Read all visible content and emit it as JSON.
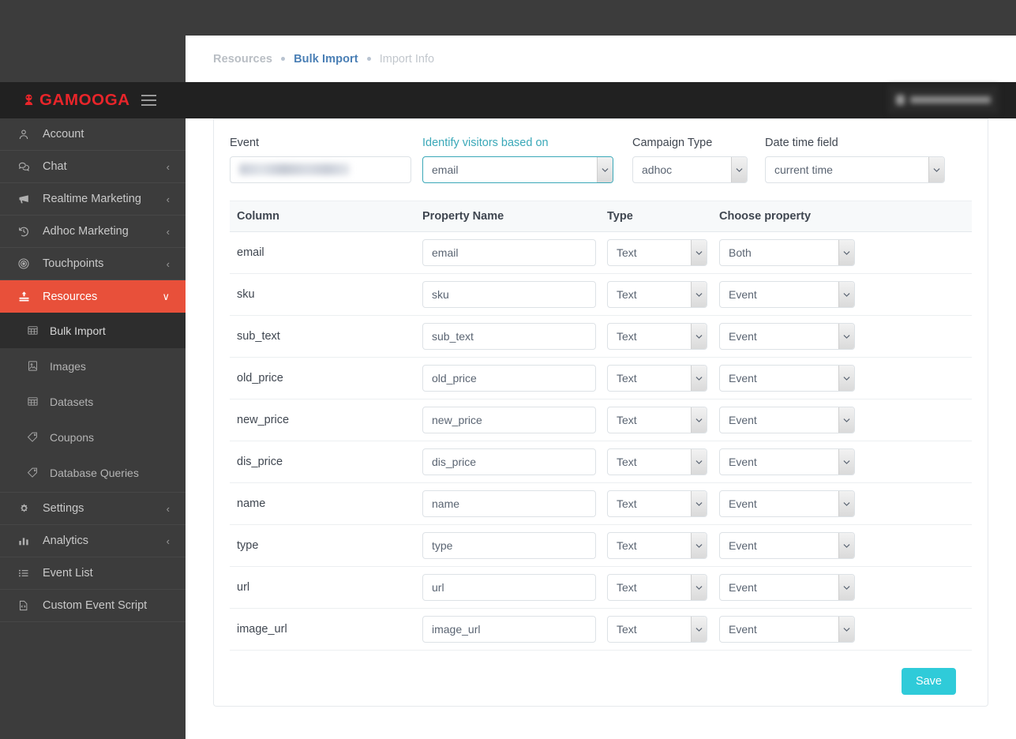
{
  "brand": {
    "name": "GAMOOGA",
    "color": "#e8252a",
    "logo_icon": "gamooga-logo-icon",
    "menu_icon": "hamburger-icon"
  },
  "user": {
    "name_redacted": true,
    "avatar_icon": "user-avatar-icon"
  },
  "breadcrumb": {
    "root": "Resources",
    "section": "Bulk Import",
    "current": "Import Info",
    "separator_icon": "dot-separator-icon"
  },
  "sidebar": {
    "items": [
      {
        "label": "Account",
        "icon": "user-icon",
        "caret": "",
        "active": false
      },
      {
        "label": "Chat",
        "icon": "chat-bubbles-icon",
        "caret": "‹",
        "active": false
      },
      {
        "label": "Realtime Marketing",
        "icon": "megaphone-icon",
        "caret": "‹",
        "active": false
      },
      {
        "label": "Adhoc Marketing",
        "icon": "history-icon",
        "caret": "‹",
        "active": false
      },
      {
        "label": "Touchpoints",
        "icon": "target-icon",
        "caret": "‹",
        "active": false
      },
      {
        "label": "Resources",
        "icon": "upload-icon",
        "caret": "∨",
        "active": true
      }
    ],
    "sub_items": [
      {
        "label": "Bulk Import",
        "icon": "table-grid-icon",
        "selected": true
      },
      {
        "label": "Images",
        "icon": "image-icon",
        "selected": false
      },
      {
        "label": "Datasets",
        "icon": "table-grid-icon",
        "selected": false
      },
      {
        "label": "Coupons",
        "icon": "tag-icon",
        "selected": false
      },
      {
        "label": "Database Queries",
        "icon": "tag-icon",
        "selected": false
      }
    ],
    "items_bottom": [
      {
        "label": "Settings",
        "icon": "gears-icon",
        "caret": "‹"
      },
      {
        "label": "Analytics",
        "icon": "bar-chart-icon",
        "caret": "‹"
      },
      {
        "label": "Event List",
        "icon": "list-icon",
        "caret": ""
      },
      {
        "label": "Custom Event Script",
        "icon": "code-file-icon",
        "caret": ""
      }
    ]
  },
  "form": {
    "event": {
      "label": "Event",
      "value": "",
      "redacted": true
    },
    "identify_visitors": {
      "label": "Identify visitors based on",
      "value": "email",
      "highlighted": true,
      "accent": "#3aa8b8"
    },
    "campaign_type": {
      "label": "Campaign Type",
      "value": "adhoc"
    },
    "date_time_field": {
      "label": "Date time field",
      "value": "current time"
    }
  },
  "table": {
    "headers": [
      "Column",
      "Property Name",
      "Type",
      "Choose property"
    ],
    "rows": [
      {
        "column": "email",
        "property_name": "email",
        "type": "Text",
        "choose_property": "Both"
      },
      {
        "column": "sku",
        "property_name": "sku",
        "type": "Text",
        "choose_property": "Event"
      },
      {
        "column": "sub_text",
        "property_name": "sub_text",
        "type": "Text",
        "choose_property": "Event"
      },
      {
        "column": "old_price",
        "property_name": "old_price",
        "type": "Text",
        "choose_property": "Event"
      },
      {
        "column": "new_price",
        "property_name": "new_price",
        "type": "Text",
        "choose_property": "Event"
      },
      {
        "column": "dis_price",
        "property_name": "dis_price",
        "type": "Text",
        "choose_property": "Event"
      },
      {
        "column": "name",
        "property_name": "name",
        "type": "Text",
        "choose_property": "Event"
      },
      {
        "column": "type",
        "property_name": "type",
        "type": "Text",
        "choose_property": "Event"
      },
      {
        "column": "url",
        "property_name": "url",
        "type": "Text",
        "choose_property": "Event"
      },
      {
        "column": "image_url",
        "property_name": "image_url",
        "type": "Text",
        "choose_property": "Event"
      }
    ]
  },
  "actions": {
    "save_label": "Save",
    "save_color": "#2fcbd9"
  }
}
